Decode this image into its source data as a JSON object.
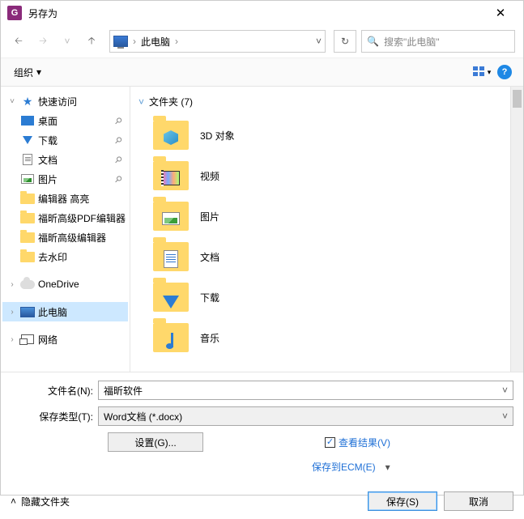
{
  "title": "另存为",
  "app_icon_letter": "G",
  "nav": {
    "location_icon": "此电脑",
    "crumb": "此电脑",
    "search_placeholder": "搜索\"此电脑\""
  },
  "toolbar": {
    "organize": "组织",
    "help": "?"
  },
  "tree": {
    "quick_access": "快速访问",
    "desktop": "桌面",
    "downloads": "下载",
    "documents": "文档",
    "pictures": "图片",
    "editor_hl": "编辑器 高亮",
    "foxit_adv_pdf": "福昕高级PDF编辑器",
    "foxit_adv": "福昕高级编辑器",
    "remove_wm": "去水印",
    "onedrive": "OneDrive",
    "this_pc": "此电脑",
    "network": "网络"
  },
  "content": {
    "group_label": "文件夹 (7)",
    "items": [
      {
        "name": "3D 对象",
        "overlay": "ov-3d"
      },
      {
        "name": "视频",
        "overlay": "ov-vid"
      },
      {
        "name": "图片",
        "overlay": "ov-pic"
      },
      {
        "name": "文档",
        "overlay": "ov-doc"
      },
      {
        "name": "下载",
        "overlay": "ov-down"
      },
      {
        "name": "音乐",
        "overlay": "ov-music"
      }
    ]
  },
  "form": {
    "filename_label": "文件名(N):",
    "filename_value": "福昕软件",
    "filetype_label": "保存类型(T):",
    "filetype_value": "Word文档 (*.docx)",
    "settings_btn": "设置(G)...",
    "view_results": "查看结果(V)",
    "save_ecm": "保存到ECM(E)"
  },
  "footer": {
    "hide_folders": "隐藏文件夹",
    "save": "保存(S)",
    "cancel": "取消"
  }
}
